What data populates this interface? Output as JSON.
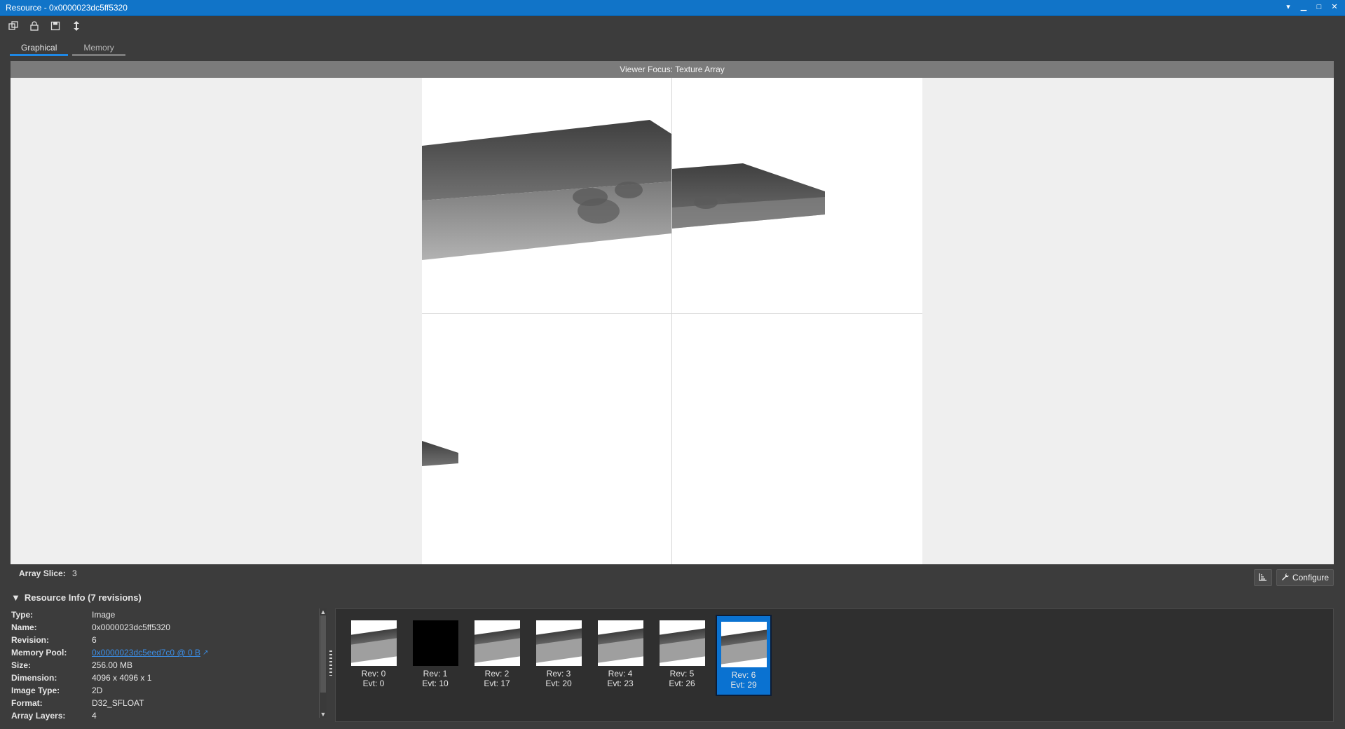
{
  "window": {
    "title": "Resource - 0x0000023dc5ff5320"
  },
  "tabs": [
    {
      "label": "Graphical",
      "active": true
    },
    {
      "label": "Memory",
      "active": false
    }
  ],
  "viewer": {
    "header": "Viewer Focus: Texture Array"
  },
  "array_slice": {
    "label": "Array Slice:",
    "value": "3"
  },
  "tools": {
    "configure_label": "Configure"
  },
  "resource_info": {
    "title": "Resource Info (7 revisions)",
    "rows": [
      {
        "label": "Type:",
        "value": "Image"
      },
      {
        "label": "Name:",
        "value": "0x0000023dc5ff5320"
      },
      {
        "label": "Revision:",
        "value": "6"
      },
      {
        "label": "Memory Pool:",
        "value": "0x0000023dc5eed7c0 @ 0 B"
      },
      {
        "label": "Size:",
        "value": "256.00 MB"
      },
      {
        "label": "Dimension:",
        "value": "4096 x 4096 x 1"
      },
      {
        "label": "Image Type:",
        "value": "2D"
      },
      {
        "label": "Format:",
        "value": "D32_SFLOAT"
      },
      {
        "label": "Array Layers:",
        "value": "4"
      }
    ]
  },
  "revisions": [
    {
      "rev": "Rev: 0",
      "evt": "Evt: 0",
      "thumb": "scene"
    },
    {
      "rev": "Rev: 1",
      "evt": "Evt: 10",
      "thumb": "black"
    },
    {
      "rev": "Rev: 2",
      "evt": "Evt: 17",
      "thumb": "scene"
    },
    {
      "rev": "Rev: 3",
      "evt": "Evt: 20",
      "thumb": "scene"
    },
    {
      "rev": "Rev: 4",
      "evt": "Evt: 23",
      "thumb": "scene"
    },
    {
      "rev": "Rev: 5",
      "evt": "Evt: 26",
      "thumb": "scene"
    },
    {
      "rev": "Rev: 6",
      "evt": "Evt: 29",
      "thumb": "scene",
      "selected": true
    }
  ],
  "icons": {
    "toolbar": [
      "copy-window-icon",
      "lock-icon",
      "save-icon",
      "resize-vertical-icon"
    ],
    "title_controls": [
      "dropdown-icon",
      "minimize-icon",
      "maximize-icon",
      "close-icon"
    ]
  },
  "colors": {
    "accent": "#1174c8",
    "selected": "#0a72d1",
    "link": "#3b8ee6"
  }
}
